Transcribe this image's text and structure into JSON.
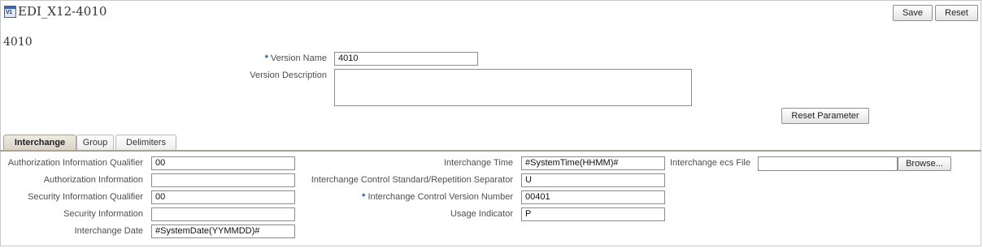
{
  "header": {
    "title": "EDI_X12-4010",
    "icon_text": "V1",
    "save_label": "Save",
    "reset_label": "Reset"
  },
  "version_heading": "4010",
  "form": {
    "version_name_label": "Version Name",
    "version_name_value": "4010",
    "version_description_label": "Version Description",
    "version_description_value": "",
    "reset_parameter_label": "Reset Parameter"
  },
  "tabs": [
    {
      "label": "Interchange",
      "active": true
    },
    {
      "label": "Group",
      "active": false
    },
    {
      "label": "Delimiters",
      "active": false
    }
  ],
  "interchange": {
    "col1": [
      {
        "label": "Authorization Information Qualifier",
        "value": "00"
      },
      {
        "label": "Authorization Information",
        "value": ""
      },
      {
        "label": "Security Information Qualifier",
        "value": "00"
      },
      {
        "label": "Security Information",
        "value": ""
      },
      {
        "label": "Interchange Date",
        "value": "#SystemDate(YYMMDD)#"
      }
    ],
    "col2": [
      {
        "label": "Interchange Time",
        "value": "#SystemTime(HHMM)#",
        "required": false
      },
      {
        "label": "Interchange Control Standard/Repetition Separator",
        "value": "U",
        "required": false
      },
      {
        "label": "Interchange Control Version Number",
        "value": "00401",
        "required": true
      },
      {
        "label": "Usage Indicator",
        "value": "P",
        "required": false
      }
    ],
    "ecs_file_label": "Interchange ecs File",
    "ecs_file_value": "",
    "browse_label": "Browse..."
  },
  "required_marker": "*",
  "colors": {
    "required": "#1a56b4",
    "tab_active": "#d9d3c6",
    "label": "#4f4f4f"
  }
}
